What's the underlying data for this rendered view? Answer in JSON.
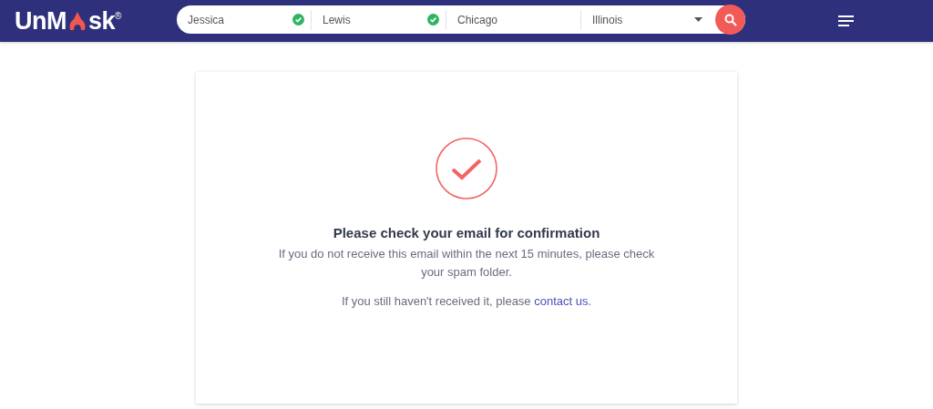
{
  "header": {
    "logo": {
      "before": "UnM",
      "after": "sk",
      "mark": "®"
    },
    "search": {
      "fields": [
        {
          "kind": "text",
          "value": "Jessica",
          "validated": true
        },
        {
          "kind": "text",
          "value": "Lewis",
          "validated": true
        },
        {
          "kind": "text",
          "value": "Chicago",
          "validated": false
        },
        {
          "kind": "select",
          "value": "Illinois"
        }
      ]
    }
  },
  "card": {
    "title": "Please check your email for confirmation",
    "message": "If you do not receive this email within the next 15 minutes, please check your spam folder.",
    "help": {
      "text": "If you still haven't received it, please ",
      "link": "contact us",
      "end": "."
    }
  }
}
